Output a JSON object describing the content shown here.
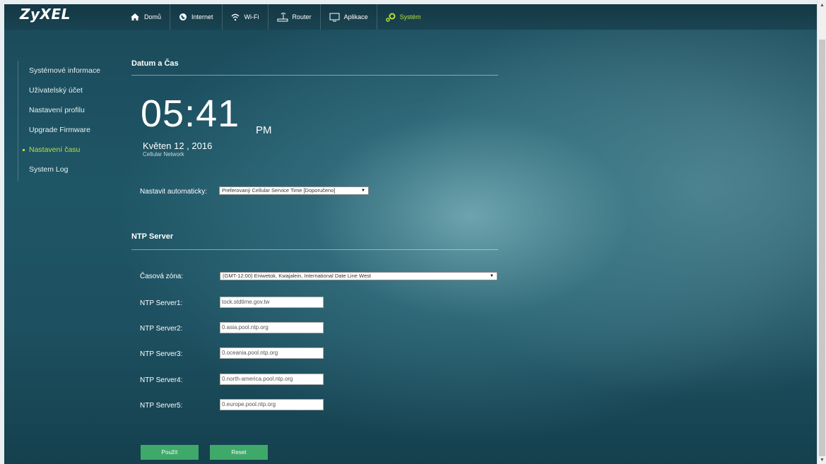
{
  "brand": {
    "logo": "ZyXEL"
  },
  "nav": {
    "items": [
      {
        "label": "Domů",
        "icon": "home-icon"
      },
      {
        "label": "Internet",
        "icon": "globe-icon"
      },
      {
        "label": "Wi-Fi",
        "icon": "wifi-icon"
      },
      {
        "label": "Router",
        "icon": "router-icon"
      },
      {
        "label": "Aplikace",
        "icon": "monitor-icon"
      },
      {
        "label": "Systém",
        "icon": "gear-icon",
        "active": true
      }
    ],
    "active_color": "#b5e03c"
  },
  "sidebar": {
    "items": [
      {
        "label": "Systémové informace"
      },
      {
        "label": "Uživatelský účet"
      },
      {
        "label": "Nastavení profilu"
      },
      {
        "label": "Upgrade Firmware"
      },
      {
        "label": "Nastavení času",
        "active": true
      },
      {
        "label": "System Log"
      }
    ]
  },
  "datetime": {
    "title": "Datum a Čas",
    "time": "05:41",
    "ampm": "PM",
    "date": "Květen 12 , 2016",
    "source": "Cellular Network",
    "auto_label": "Nastavit automaticky:",
    "auto_value": "Preferovaný Cellular Service Time [Doporučeno]"
  },
  "ntp": {
    "title": "NTP Server",
    "timezone_label": "Časová zóna:",
    "timezone_value": "(GMT-12:00) Eniwetok, Kwajalein, International Date Line West",
    "servers": [
      {
        "label": "NTP Server1:",
        "value": "tock.stdtime.gov.tw"
      },
      {
        "label": "NTP Server2:",
        "value": "0.asia.pool.ntp.org"
      },
      {
        "label": "NTP Server3:",
        "value": "0.oceania.pool.ntp.org"
      },
      {
        "label": "NTP Server4:",
        "value": "0.north-america.pool.ntp.org"
      },
      {
        "label": "NTP Server5:",
        "value": "0.europe.pool.ntp.org"
      }
    ]
  },
  "actions": {
    "apply": "Použít",
    "reset": "Reset",
    "button_color": "#3fa96a"
  }
}
